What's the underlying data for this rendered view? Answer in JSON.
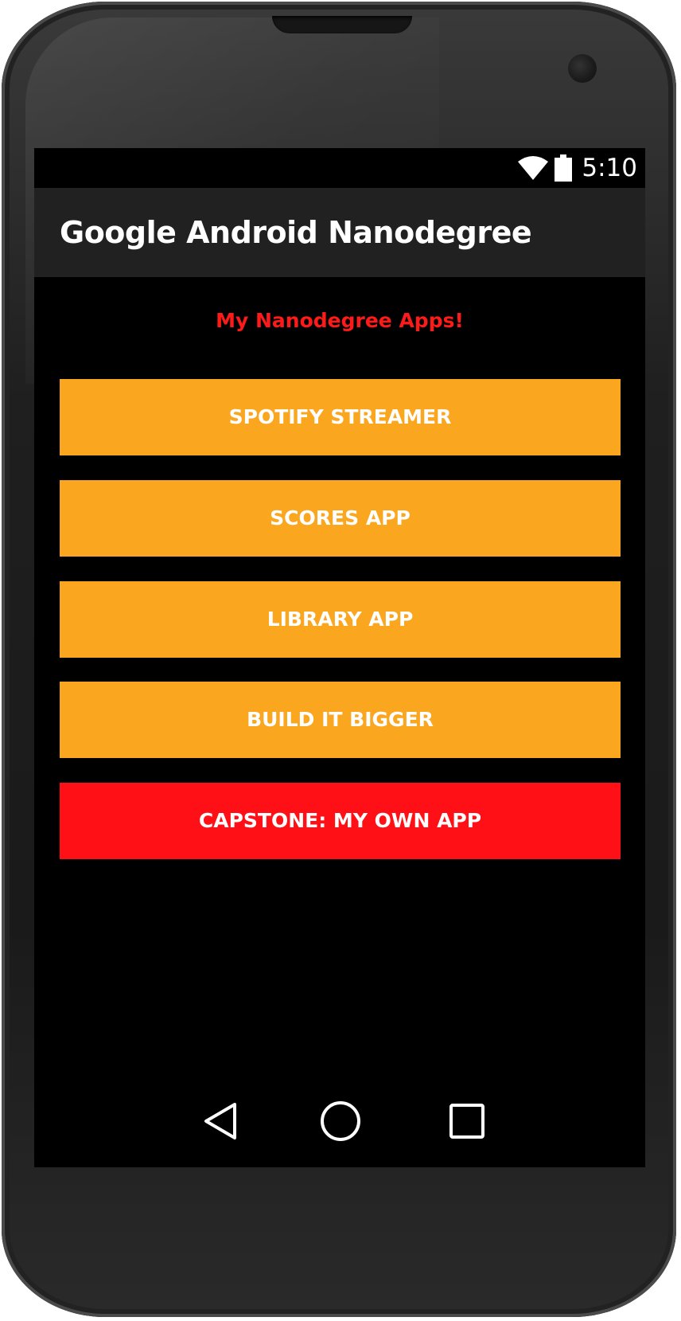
{
  "status_bar": {
    "time": "5:10",
    "wifi_icon": "wifi-full-icon",
    "battery_icon": "battery-full-icon"
  },
  "app_bar": {
    "title": "Google Android Nanodegree"
  },
  "main": {
    "heading": "My Nanodegree Apps!",
    "heading_color": "#ff1a1a",
    "buttons": [
      {
        "label": "SPOTIFY STREAMER",
        "color": "#fba61f"
      },
      {
        "label": "SCORES APP",
        "color": "#fba61f"
      },
      {
        "label": "LIBRARY APP",
        "color": "#fba61f"
      },
      {
        "label": "BUILD IT BIGGER",
        "color": "#fba61f"
      },
      {
        "label": "CAPSTONE: MY OWN APP",
        "color": "#ff1016"
      }
    ]
  },
  "nav_bar": {
    "back_icon": "back-triangle-icon",
    "home_icon": "home-circle-icon",
    "recents_icon": "recents-square-icon"
  },
  "colors": {
    "app_bar_background": "#212121",
    "screen_background": "#000000",
    "accent_orange": "#fba61f",
    "accent_red": "#ff1016"
  }
}
